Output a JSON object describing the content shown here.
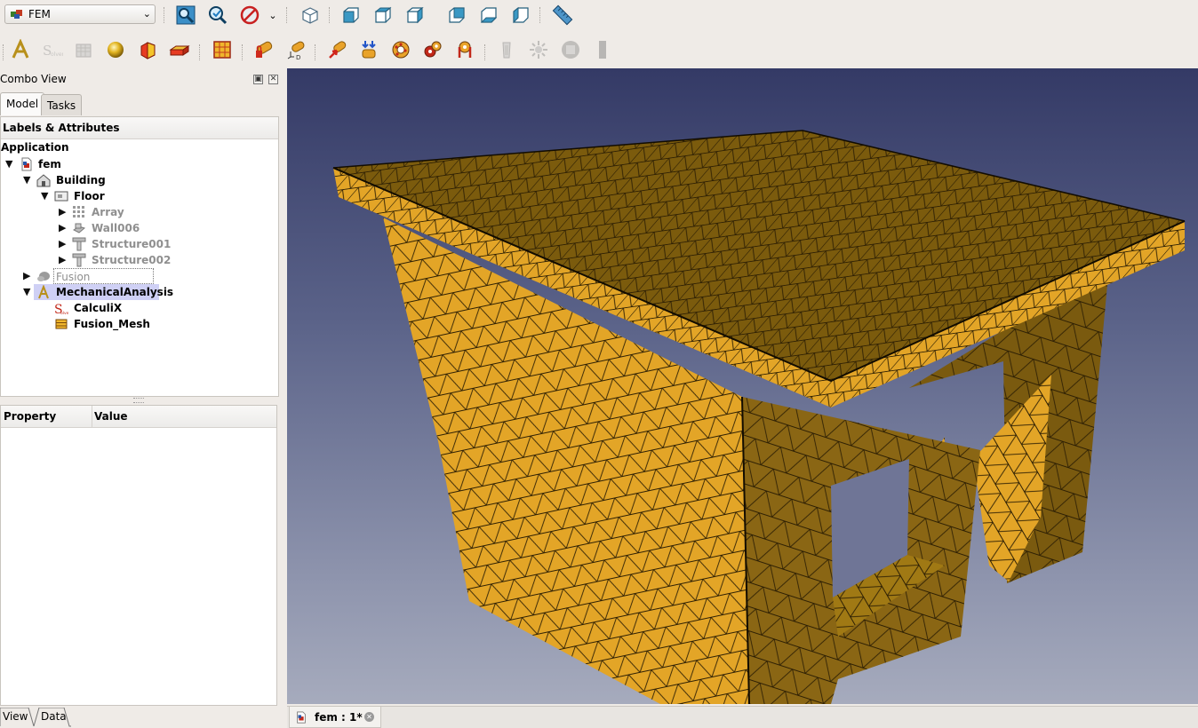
{
  "toolbar": {
    "workbench": "FEM"
  },
  "combo": {
    "title": "Combo View",
    "tabs": [
      {
        "label": "Model"
      },
      {
        "label": "Tasks"
      }
    ]
  },
  "tree": {
    "header": "Labels & Attributes",
    "root": "Application",
    "items": [
      {
        "label": "fem"
      },
      {
        "label": "Building"
      },
      {
        "label": "Floor"
      },
      {
        "label": "Array"
      },
      {
        "label": "Wall006"
      },
      {
        "label": "Structure001"
      },
      {
        "label": "Structure002"
      },
      {
        "label": "Fusion"
      },
      {
        "label": "MechanicalAnalysis"
      },
      {
        "label": "CalculiX"
      },
      {
        "label": "Fusion_Mesh"
      }
    ]
  },
  "properties": {
    "col_property": "Property",
    "col_value": "Value"
  },
  "bottom_tabs": [
    {
      "label": "View"
    },
    {
      "label": "Data"
    }
  ],
  "document_tab": {
    "label": "fem : 1*"
  },
  "colors": {
    "mesh_face": "#e3a527",
    "mesh_shade": "#7a5a0f",
    "selection": "#cfd0f5",
    "background_top": "#343a66",
    "background_bottom": "#a6abbd"
  }
}
